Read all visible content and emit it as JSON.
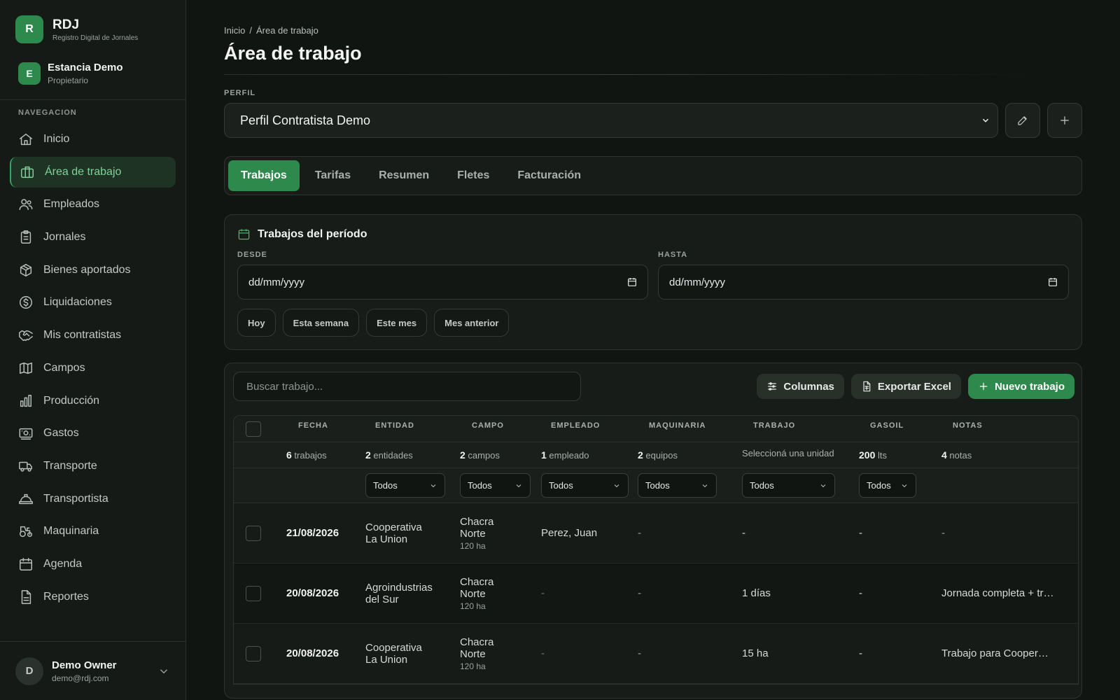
{
  "brand": {
    "logo_letter": "R",
    "name": "RDJ",
    "subtitle": "Registro Digital de Jornales"
  },
  "org": {
    "logo_letter": "E",
    "name": "Estancia Demo",
    "role": "Propietario"
  },
  "nav": {
    "title": "NAVEGACION",
    "items": [
      {
        "label": "Inicio",
        "icon": "home-icon"
      },
      {
        "label": "Área de trabajo",
        "icon": "briefcase-icon",
        "active": true
      },
      {
        "label": "Empleados",
        "icon": "users-icon"
      },
      {
        "label": "Jornales",
        "icon": "clipboard-icon"
      },
      {
        "label": "Bienes aportados",
        "icon": "package-icon"
      },
      {
        "label": "Liquidaciones",
        "icon": "dollar-circle-icon"
      },
      {
        "label": "Mis contratistas",
        "icon": "handshake-icon"
      },
      {
        "label": "Campos",
        "icon": "map-icon"
      },
      {
        "label": "Producción",
        "icon": "bar-chart-icon"
      },
      {
        "label": "Gastos",
        "icon": "banknote-icon"
      },
      {
        "label": "Transporte",
        "icon": "truck-icon"
      },
      {
        "label": "Transportista",
        "icon": "hard-hat-icon"
      },
      {
        "label": "Maquinaria",
        "icon": "tractor-icon"
      },
      {
        "label": "Agenda",
        "icon": "calendar-icon"
      },
      {
        "label": "Reportes",
        "icon": "file-text-icon"
      }
    ]
  },
  "user": {
    "avatar_letter": "D",
    "name": "Demo Owner",
    "email": "demo@rdj.com"
  },
  "breadcrumb": {
    "home": "Inicio",
    "separator": "/",
    "current": "Área de trabajo"
  },
  "page_title": "Área de trabajo",
  "profile": {
    "label": "PERFIL",
    "selected": "Perfil Contratista Demo"
  },
  "tabs": [
    "Trabajos",
    "Tarifas",
    "Resumen",
    "Fletes",
    "Facturación"
  ],
  "active_tab": "Trabajos",
  "period": {
    "title": "Trabajos del período",
    "from_label": "DESDE",
    "to_label": "HASTA",
    "from_value": "dd/mm/yyyy",
    "to_value": "dd/mm/yyyy",
    "quick": [
      "Hoy",
      "Esta semana",
      "Este mes",
      "Mes anterior"
    ]
  },
  "toolbar": {
    "search_placeholder": "Buscar trabajo...",
    "columns_label": "Columnas",
    "export_label": "Exportar Excel",
    "new_label": "Nuevo trabajo"
  },
  "table": {
    "headers": [
      "FECHA",
      "ENTIDAD",
      "CAMPO",
      "EMPLEADO",
      "MAQUINARIA",
      "TRABAJO",
      "GASOIL",
      "NOTAS"
    ],
    "summary": {
      "fecha": {
        "num": "6",
        "unit": "trabajos"
      },
      "entidad": {
        "num": "2",
        "unit": "entidades"
      },
      "campo": {
        "num": "2",
        "unit": "campos"
      },
      "empleado": {
        "num": "1",
        "unit": "empleado"
      },
      "maquinaria": {
        "num": "2",
        "unit": "equipos"
      },
      "trabajo": "Seleccioná una unidad",
      "gasoil": {
        "num": "200",
        "unit": "lts"
      },
      "notas": {
        "num": "4",
        "unit": "notas"
      }
    },
    "filter_value": "Todos",
    "rows": [
      {
        "fecha": "21/08/2026",
        "entidad_1": "Cooperativa",
        "entidad_2": "La Union",
        "campo_1": "Chacra",
        "campo_2": "Norte",
        "campo_ha": "120 ha",
        "empleado": "Perez, Juan",
        "maquinaria": "-",
        "trabajo": "-",
        "gasoil": "-",
        "notas": "-"
      },
      {
        "fecha": "20/08/2026",
        "entidad_1": "Agroindustrias",
        "entidad_2": "del Sur",
        "campo_1": "Chacra",
        "campo_2": "Norte",
        "campo_ha": "120 ha",
        "empleado": "-",
        "maquinaria": "-",
        "trabajo": "1 días",
        "gasoil": "-",
        "notas": "Jornada completa + tr…"
      },
      {
        "fecha": "20/08/2026",
        "entidad_1": "Cooperativa",
        "entidad_2": "La Union",
        "campo_1": "Chacra",
        "campo_2": "Norte",
        "campo_ha": "120 ha",
        "empleado": "-",
        "maquinaria": "-",
        "trabajo": "15 ha",
        "gasoil": "-",
        "notas": "Trabajo para Cooper…"
      }
    ]
  },
  "colors": {
    "accent": "#2e8a4c",
    "accent_text": "#7fd39a",
    "background": "#111512",
    "panel": "#171c18"
  }
}
